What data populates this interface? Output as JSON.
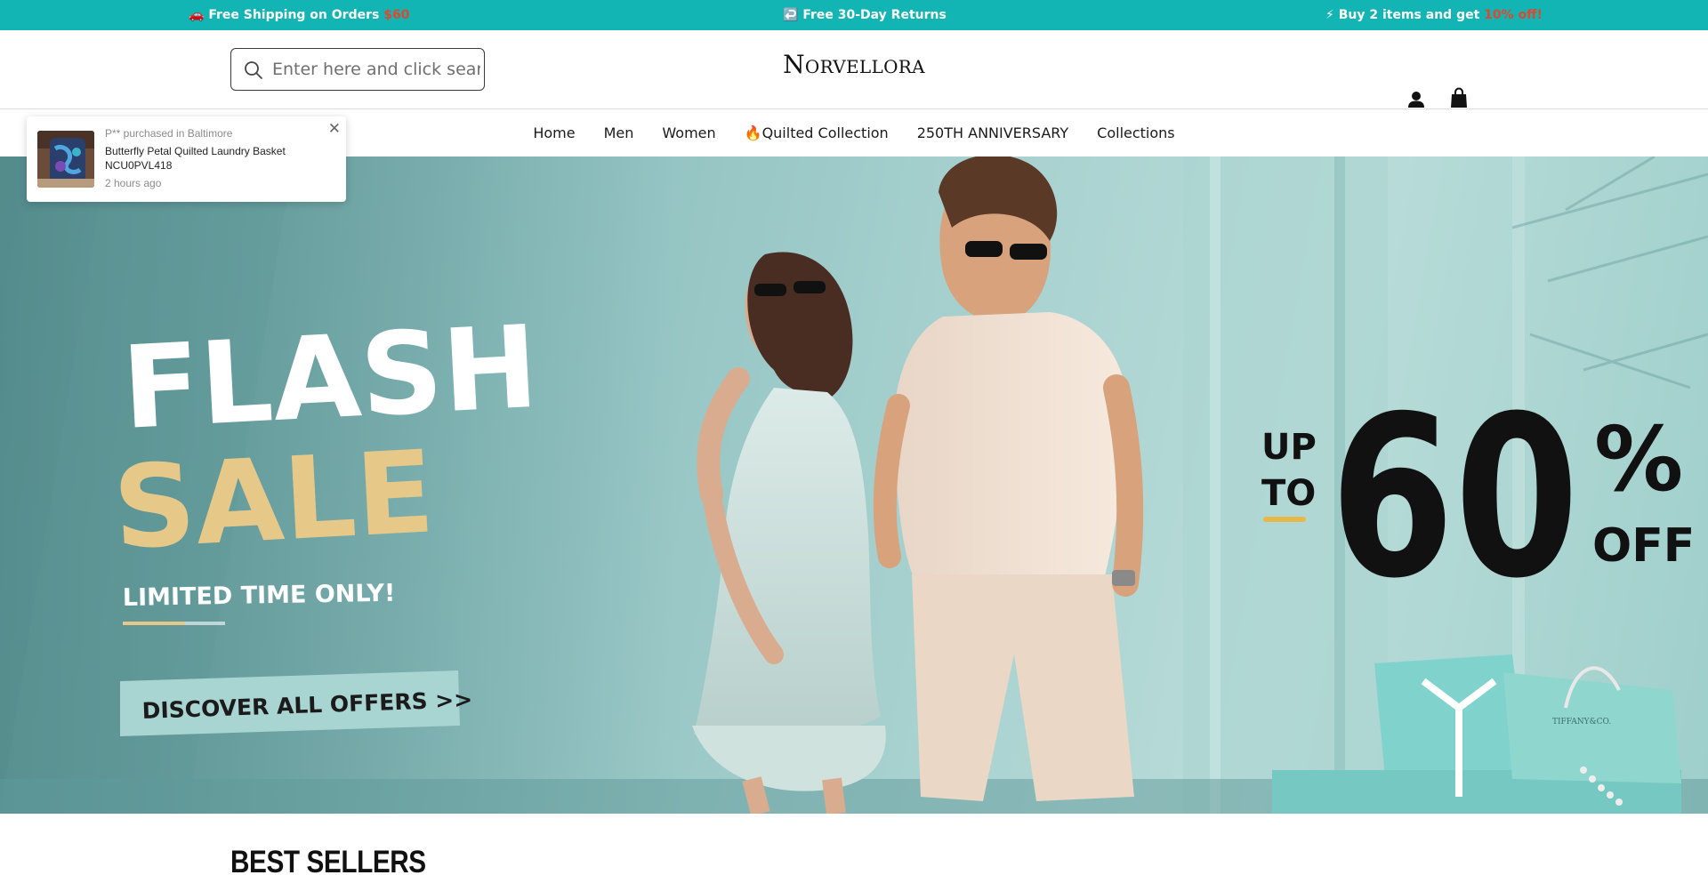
{
  "announcement": {
    "shipping_icon": "🚗",
    "shipping_text": "Free Shipping on Orders ",
    "shipping_amount": "$60",
    "returns_icon": "↩️",
    "returns_text": "Free 30-Day Returns",
    "promo_icon": "⚡",
    "promo_text": "Buy 2 items and get ",
    "promo_discount": "10% off!",
    "bar_color": "#12b5b3",
    "accent_color": "#e0472f"
  },
  "header": {
    "search_placeholder": "Enter here and click search",
    "logo": "Norvellora",
    "icons": [
      "search-icon",
      "account-icon",
      "cart-icon"
    ]
  },
  "nav": {
    "items": [
      "Home",
      "Men",
      "Women",
      "🔥Quilted Collection",
      "250TH ANNIVERSARY",
      "Collections"
    ]
  },
  "hero": {
    "line1": "FLASH",
    "line2": "SALE",
    "subtitle": "LIMITED TIME ONLY!",
    "cta": "DISCOVER ALL OFFERS >>",
    "up": "UP",
    "to": "TO",
    "percent_value": "60",
    "percent_sign": "%",
    "off": "OFF",
    "gift_bag_text": "TIFFANY&CO."
  },
  "popup": {
    "line1": "P** purchased in Baltimore",
    "product": "Butterfly Petal Quilted Laundry Basket NCU0PVL418",
    "time": "2 hours ago",
    "close_symbol": "✕"
  },
  "section": {
    "title": "BEST SELLERS"
  }
}
